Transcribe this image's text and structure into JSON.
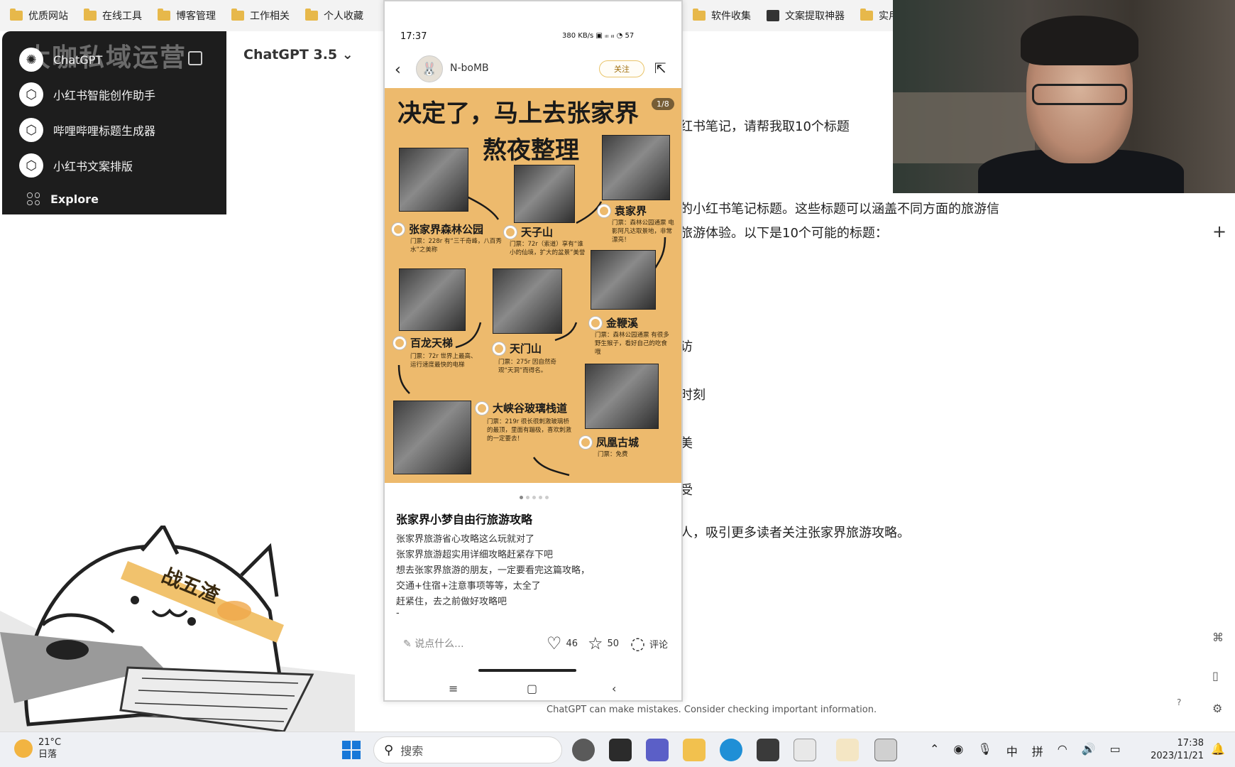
{
  "bookmarks": [
    {
      "label": "优质网站"
    },
    {
      "label": "在线工具"
    },
    {
      "label": "博客管理"
    },
    {
      "label": "工作相关"
    },
    {
      "label": "个人收藏"
    },
    {
      "label": "软件收集"
    },
    {
      "label": "文案提取神器"
    },
    {
      "label": "实用"
    }
  ],
  "sidebar": {
    "watermark": "大咖私域运营",
    "items": [
      {
        "label": "ChatGPT",
        "icon": "openai-logo-icon"
      },
      {
        "label": "小红书智能创作助手",
        "icon": "cube-icon"
      },
      {
        "label": "哔哩哔哩标题生成器",
        "icon": "cube-icon"
      },
      {
        "label": "小红书文案排版",
        "icon": "cube-icon"
      },
      {
        "label": "Explore",
        "icon": "grid-dots-icon"
      }
    ]
  },
  "chat": {
    "model": "ChatGPT 3.5 ⌄",
    "lines": [
      "红书笔记，请帮我取10个标题",
      "的小红书笔记标题。这些标题可以涵盖不同方面的旅游信",
      "旅游体验。以下是10个可能的标题：",
      "访",
      "时刻",
      "美",
      "受",
      "人，吸引更多读者关注张家界旅游攻略。"
    ],
    "footnote": "ChatGPT can make mistakes. Consider checking important information.",
    "help": "?"
  },
  "phone": {
    "time": "17:37",
    "status_right": "380 KB/s  ▣ ᵢₗₗ ᵢₗₗ ◔ 57",
    "author": "N-boMB",
    "follow_label": "关注",
    "poster": {
      "title_line1": "决定了，马上去张家界",
      "title_line2": "熬夜整理",
      "page_counter": "1/8",
      "spots": [
        {
          "name": "张家界森林公园",
          "desc": "门票：228r 有“三千奇峰，八百秀水”之美称"
        },
        {
          "name": "天子山",
          "desc": "门票：72r（索道）享有“谁小的仙境，扩大的盆景”美誉"
        },
        {
          "name": "袁家界",
          "desc": "门票：森林公园通票 电影阿凡达取景地，非常漂亮！"
        },
        {
          "name": "百龙天梯",
          "desc": "门票：72r 世界上最高、运行速度最快的电梯"
        },
        {
          "name": "天门山",
          "desc": "门票：275r 因自然奇观“天洞”而得名。"
        },
        {
          "name": "金鞭溪",
          "desc": "门票：森林公园通票 有很多野生猴子，看好自己的吃食哦"
        },
        {
          "name": "大峡谷玻璃栈道",
          "desc": "门票：219r 很长很刺激玻璃桥的最顶，里面有蹦极，喜欢刺激的一定要去！"
        },
        {
          "name": "凤凰古城",
          "desc": "门票：免费"
        }
      ]
    },
    "post_title": "张家界小梦自由行旅游攻略",
    "post_lines": [
      "张家界旅游省心攻略这么玩就对了",
      "张家界旅游超实用详细攻略赶紧存下吧",
      "想去张家界旅游的朋友，一定要看完这篇攻略，",
      "交通+住宿+注意事项等等，太全了",
      "赶紧住，去之前做好攻略吧",
      "-"
    ],
    "comment_placeholder": "说点什么...",
    "likes": "46",
    "stars": "50",
    "comment_label": "评论"
  },
  "cat_band": "战五渣",
  "taskbar": {
    "temperature": "21°C",
    "weather_desc": "日落",
    "search_placeholder": "搜索",
    "ime_lang": "中",
    "ime_mode": "拼",
    "time": "17:38",
    "date": "2023/11/21"
  },
  "colors": {
    "poster_bg": "#edba6d",
    "sidebar_bg": "#1d1d1d",
    "windows_blue": "#1878d8"
  }
}
